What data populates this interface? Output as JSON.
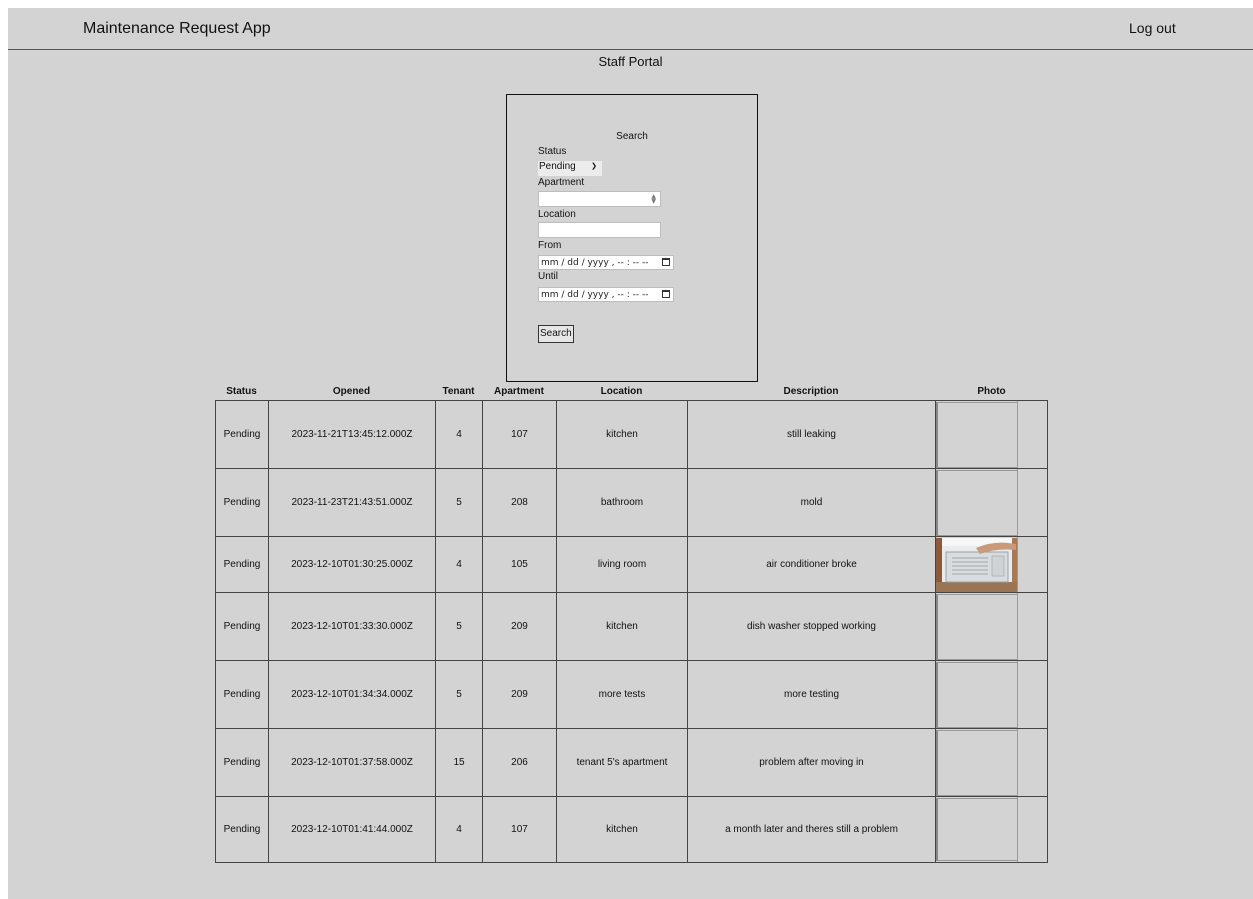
{
  "navbar": {
    "app_title": "Maintenance Request App",
    "logout_label": "Log out"
  },
  "portal_title": "Staff Portal",
  "search": {
    "title": "Search",
    "status_label": "Status",
    "status_selected": "Pending",
    "apartment_label": "Apartment",
    "apartment_value": "",
    "location_label": "Location",
    "location_value": "",
    "from_label": "From",
    "from_placeholder": "mm / dd / yyyy ,  -- : --  --",
    "until_label": "Until",
    "until_placeholder": "mm / dd / yyyy ,  -- : --  --",
    "button_label": "Search"
  },
  "table": {
    "headers": [
      "Status",
      "Opened",
      "Tenant",
      "Apartment",
      "Location",
      "Description",
      "Photo"
    ],
    "rows": [
      {
        "status": "Pending",
        "opened": "2023-11-21T13:45:12.000Z",
        "tenant": "4",
        "apartment": "107",
        "location": "kitchen",
        "description": "still leaking",
        "photo": "empty"
      },
      {
        "status": "Pending",
        "opened": "2023-11-23T21:43:51.000Z",
        "tenant": "5",
        "apartment": "208",
        "location": "bathroom",
        "description": "mold",
        "photo": "empty"
      },
      {
        "status": "Pending",
        "opened": "2023-12-10T01:30:25.000Z",
        "tenant": "4",
        "apartment": "105",
        "location": "living room",
        "description": "air conditioner broke",
        "photo": "air-conditioner-photo"
      },
      {
        "status": "Pending",
        "opened": "2023-12-10T01:33:30.000Z",
        "tenant": "5",
        "apartment": "209",
        "location": "kitchen",
        "description": "dish washer stopped working",
        "photo": "empty"
      },
      {
        "status": "Pending",
        "opened": "2023-12-10T01:34:34.000Z",
        "tenant": "5",
        "apartment": "209",
        "location": "more tests",
        "description": "more testing",
        "photo": "empty"
      },
      {
        "status": "Pending",
        "opened": "2023-12-10T01:37:58.000Z",
        "tenant": "15",
        "apartment": "206",
        "location": "tenant 5's apartment",
        "description": "problem after moving in",
        "photo": "empty"
      },
      {
        "status": "Pending",
        "opened": "2023-12-10T01:41:44.000Z",
        "tenant": "4",
        "apartment": "107",
        "location": "kitchen",
        "description": "a month later and theres still a problem",
        "photo": "empty"
      }
    ]
  }
}
